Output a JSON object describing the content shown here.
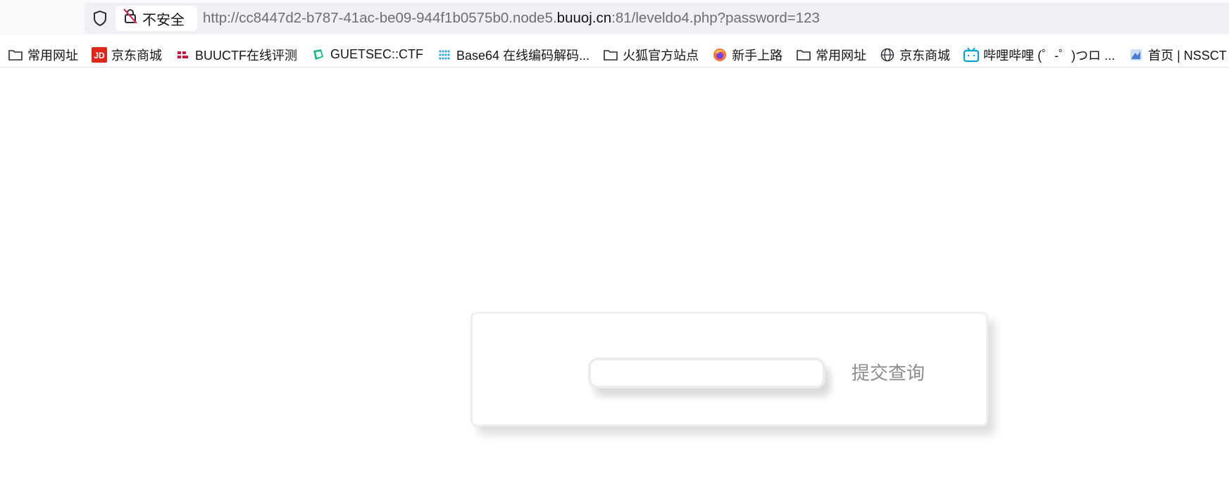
{
  "browser": {
    "security_label": "不安全",
    "url": {
      "prefix": "http://cc8447d2-b787-41ac-be09-944f1b0575b0.node5.",
      "domain": "buuoj.cn",
      "suffix": ":81/leveldo4.php?password=123"
    }
  },
  "bookmarks": [
    {
      "label": "常用网址",
      "icon": "folder-icon"
    },
    {
      "label": "京东商城",
      "icon": "jd-icon",
      "color": "#e1251b"
    },
    {
      "label": "BUUCTF在线评测",
      "icon": "buuctf-icon",
      "color": "#d0143b"
    },
    {
      "label": "GUETSEC::CTF",
      "icon": "guetsec-icon",
      "color": "#19b38a"
    },
    {
      "label": "Base64 在线编码解码...",
      "icon": "base64-icon",
      "color": "#3aa8d8"
    },
    {
      "label": "火狐官方站点",
      "icon": "folder-icon"
    },
    {
      "label": "新手上路",
      "icon": "firefox-icon",
      "color": "#ff7139"
    },
    {
      "label": "常用网址",
      "icon": "folder-icon"
    },
    {
      "label": "京东商城",
      "icon": "globe-icon"
    },
    {
      "label": "哔哩哔哩 (゜-゜)つロ ...",
      "icon": "bilibili-icon",
      "color": "#00a1d6"
    },
    {
      "label": "首页 | NSSCT",
      "icon": "nssctf-icon",
      "color": "#4a7bd4"
    }
  ],
  "form": {
    "password_value": "",
    "submit_label": "提交查询"
  }
}
